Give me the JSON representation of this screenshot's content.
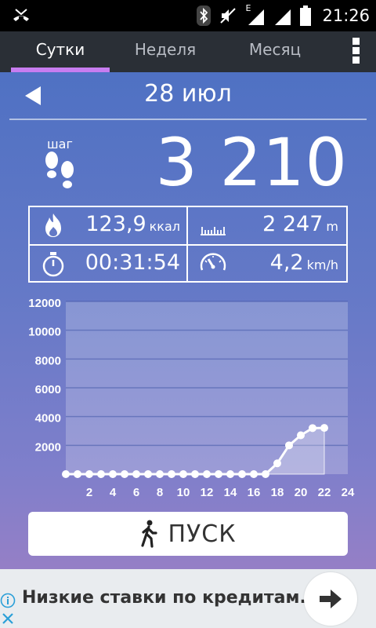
{
  "status_bar": {
    "time": "21:26",
    "network_label": "E",
    "icons": [
      "missed-call-icon",
      "bluetooth-icon",
      "mute-icon",
      "signal-icon",
      "signal-icon",
      "battery-icon"
    ]
  },
  "tabs": [
    {
      "label": "Сутки",
      "active": true
    },
    {
      "label": "Неделя",
      "active": false
    },
    {
      "label": "Месяц",
      "active": false
    }
  ],
  "date": "28 июл",
  "steps": {
    "label": "шаг",
    "value": "3 210"
  },
  "stats": {
    "calories": {
      "value": "123,9",
      "unit": "ккал"
    },
    "distance": {
      "value": "2 247",
      "unit": "m"
    },
    "duration": {
      "value": "00:31:54"
    },
    "speed": {
      "value": "4,2",
      "unit": "km/h"
    }
  },
  "chart_data": {
    "type": "line",
    "x_ticks": [
      "2",
      "4",
      "6",
      "8",
      "10",
      "12",
      "14",
      "16",
      "18",
      "20",
      "22",
      "24"
    ],
    "y_ticks": [
      "2000",
      "4000",
      "6000",
      "8000",
      "10000",
      "12000"
    ],
    "ylim": [
      0,
      12000
    ],
    "xlim": [
      0,
      24
    ],
    "x": [
      0,
      1,
      2,
      3,
      4,
      5,
      6,
      7,
      8,
      9,
      10,
      11,
      12,
      13,
      14,
      15,
      16,
      17,
      18,
      19,
      20,
      21,
      22
    ],
    "y": [
      0,
      0,
      0,
      0,
      0,
      0,
      0,
      0,
      0,
      0,
      0,
      0,
      0,
      0,
      0,
      0,
      0,
      0,
      750,
      2000,
      2700,
      3200,
      3210
    ],
    "grid": true
  },
  "start_button": {
    "label": "ПУСК"
  },
  "ad": {
    "text": "Низкие ставки по кредитам."
  },
  "colors": {
    "accent": "#c77df0",
    "tabbar": "#2a2f36"
  }
}
